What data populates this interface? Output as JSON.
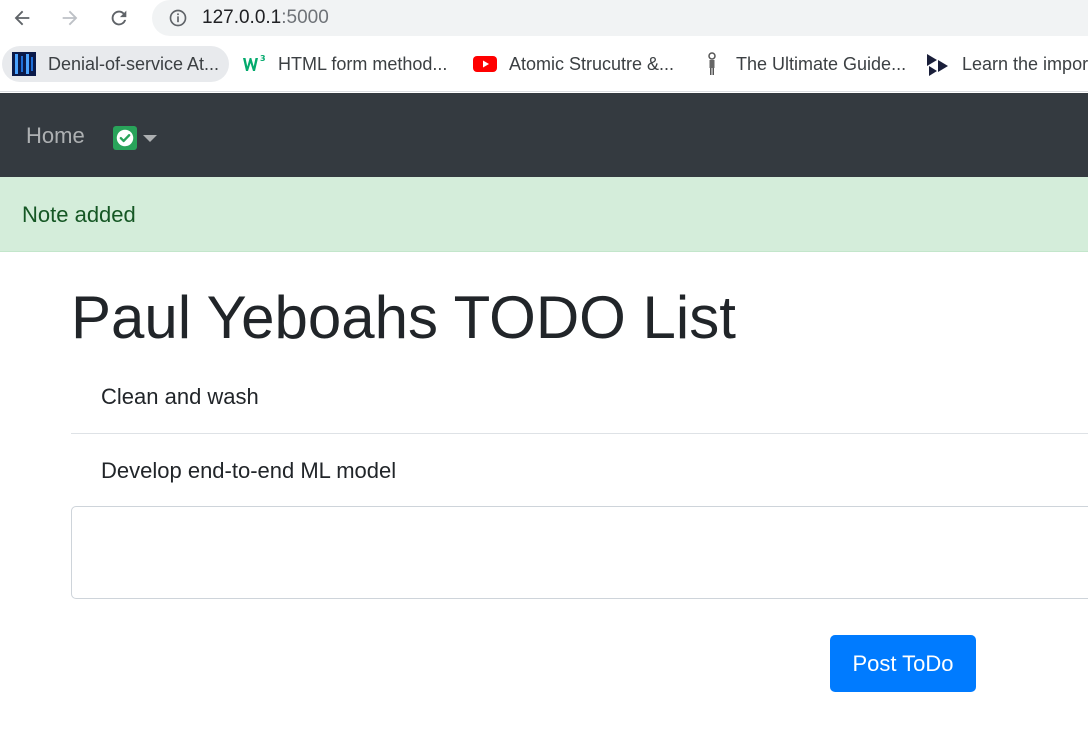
{
  "browser": {
    "url_host": "127.0.0.1",
    "url_port": ":5000",
    "bookmarks": [
      {
        "label": "Denial-of-service At...",
        "icon": "binary-code-icon"
      },
      {
        "label": "HTML form method...",
        "icon": "w3schools-icon"
      },
      {
        "label": "Atomic Strucutre &...",
        "icon": "youtube-icon"
      },
      {
        "label": "The Ultimate Guide...",
        "icon": "person-figure-icon"
      },
      {
        "label": "Learn the impor",
        "icon": "play-logo-icon"
      }
    ]
  },
  "navbar": {
    "home_label": "Home",
    "dropdown_icon": "checkbox-icon",
    "background": "#343a40"
  },
  "alert": {
    "message": "Note added",
    "background": "#d4edda",
    "text_color": "#155724"
  },
  "main": {
    "title": "Paul Yeboahs TODO List",
    "todos": [
      {
        "text": "Clean and wash"
      },
      {
        "text": "Develop end-to-end ML model"
      }
    ],
    "input": {
      "value": "",
      "placeholder": ""
    },
    "post_button_label": "Post ToDo",
    "accent": "#007bff"
  }
}
